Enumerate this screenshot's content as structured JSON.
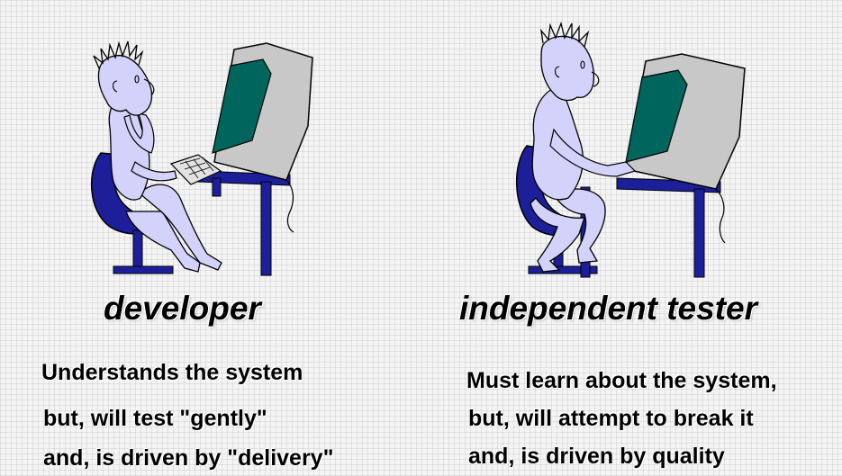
{
  "colors": {
    "skin": "#d3d2fb",
    "chair": "#1d1f9a",
    "desk": "#1d1f9a",
    "monitor_body": "#c8c8c8",
    "screen": "#00655d",
    "outline": "#000000",
    "text": "#000000"
  },
  "developer": {
    "illustration": "developer-at-computer",
    "caption": "developer",
    "lines": [
      "Understands the system",
      "but, will test \"gently\"",
      "and, is driven by \"delivery\""
    ]
  },
  "tester": {
    "illustration": "tester-at-computer",
    "caption": "independent tester",
    "lines": [
      "Must learn about the system,",
      "but, will attempt to break it",
      "and, is driven by quality"
    ]
  }
}
